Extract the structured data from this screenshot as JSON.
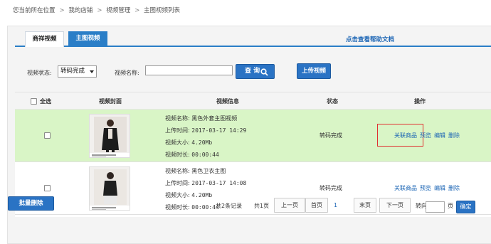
{
  "breadcrumb": {
    "prefix": "您当前所在位置",
    "items": [
      "我的店铺",
      "视频管理",
      "主图视频列表"
    ]
  },
  "tabs": [
    {
      "label": "商祥视频",
      "active": false
    },
    {
      "label": "主图视频",
      "active": true
    }
  ],
  "help_link": "点击查看帮助文档",
  "filter": {
    "status_label": "视频状态:",
    "status_value": "转码完成",
    "name_label": "视频名称:",
    "name_value": "",
    "query_label": "查 询",
    "upload_label": "上传视频"
  },
  "table": {
    "headers": {
      "select_all": "全选",
      "cover": "视频封面",
      "info": "视频信息",
      "status": "状态",
      "ops": "操作"
    },
    "rows": [
      {
        "name_label": "视频名称:",
        "name": "黑色外套主图视频",
        "time_label": "上传时间:",
        "time": "2017-03-17 14:29",
        "size_label": "视频大小:",
        "size": "4.20Mb",
        "duration_label": "视频时长:",
        "duration": "00:00:44",
        "status": "转码完成",
        "highlighted": true,
        "ops": [
          "关联商品",
          "预览",
          "编辑",
          "删除"
        ]
      },
      {
        "name_label": "视频名称:",
        "name": "黑色卫衣主图",
        "time_label": "上传时间:",
        "time": "2017-03-17 14:08",
        "size_label": "视频大小:",
        "size": "4.20Mb",
        "duration_label": "视频时长:",
        "duration": "00:00:44",
        "status": "转码完成",
        "highlighted": false,
        "ops": [
          "关联商品",
          "预览",
          "编辑",
          "删除"
        ]
      }
    ]
  },
  "bulk_delete": "批量删除",
  "pagination": {
    "total": "共2条记录",
    "pages": "共1页",
    "prev": "上一页",
    "first": "首页",
    "current": "1",
    "last": "末页",
    "next": "下一页",
    "goto_label": "转向第",
    "goto_value": "",
    "page_unit": "页",
    "ok": "确定"
  },
  "colors": {
    "accent": "#2a73c4",
    "highlight_row": "#d9f5c6",
    "link": "#1a64b4",
    "marker": "#e03030"
  }
}
